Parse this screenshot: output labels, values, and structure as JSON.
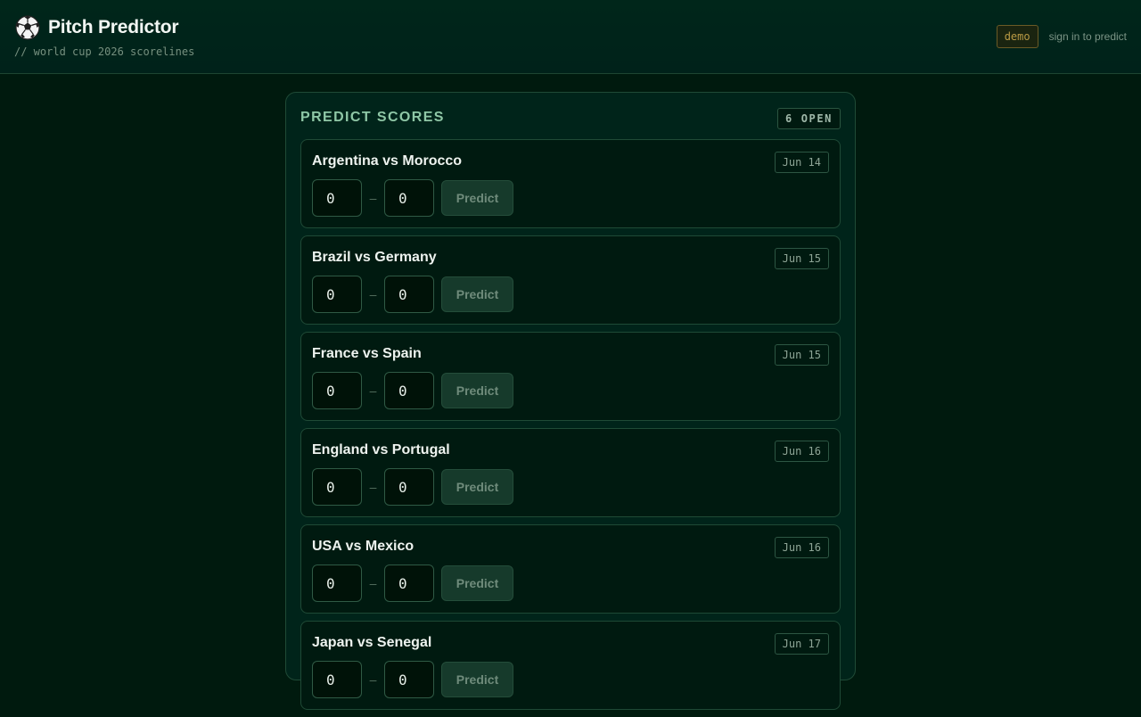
{
  "header": {
    "title": "Pitch Predictor",
    "subtitle": "// world cup 2026 scorelines",
    "demo_badge": "demo",
    "signin_link": "sign in to predict"
  },
  "panel": {
    "title": "PREDICT SCORES",
    "open_badge": "6 OPEN"
  },
  "matches": [
    {
      "name": "Argentina vs Morocco",
      "date": "Jun 14",
      "home_score": "0",
      "away_score": "0",
      "dash": "–",
      "button": "Predict"
    },
    {
      "name": "Brazil vs Germany",
      "date": "Jun 15",
      "home_score": "0",
      "away_score": "0",
      "dash": "–",
      "button": "Predict"
    },
    {
      "name": "France vs Spain",
      "date": "Jun 15",
      "home_score": "0",
      "away_score": "0",
      "dash": "–",
      "button": "Predict"
    },
    {
      "name": "England vs Portugal",
      "date": "Jun 16",
      "home_score": "0",
      "away_score": "0",
      "dash": "–",
      "button": "Predict"
    },
    {
      "name": "USA vs Mexico",
      "date": "Jun 16",
      "home_score": "0",
      "away_score": "0",
      "dash": "–",
      "button": "Predict"
    },
    {
      "name": "Japan vs Senegal",
      "date": "Jun 17",
      "home_score": "0",
      "away_score": "0",
      "dash": "–",
      "button": "Predict"
    }
  ],
  "icons": {
    "brand": "soccer-ball-icon"
  },
  "colors": {
    "background": "#001a0e",
    "accent": "#8fc7a6",
    "demo": "#b99a45"
  }
}
